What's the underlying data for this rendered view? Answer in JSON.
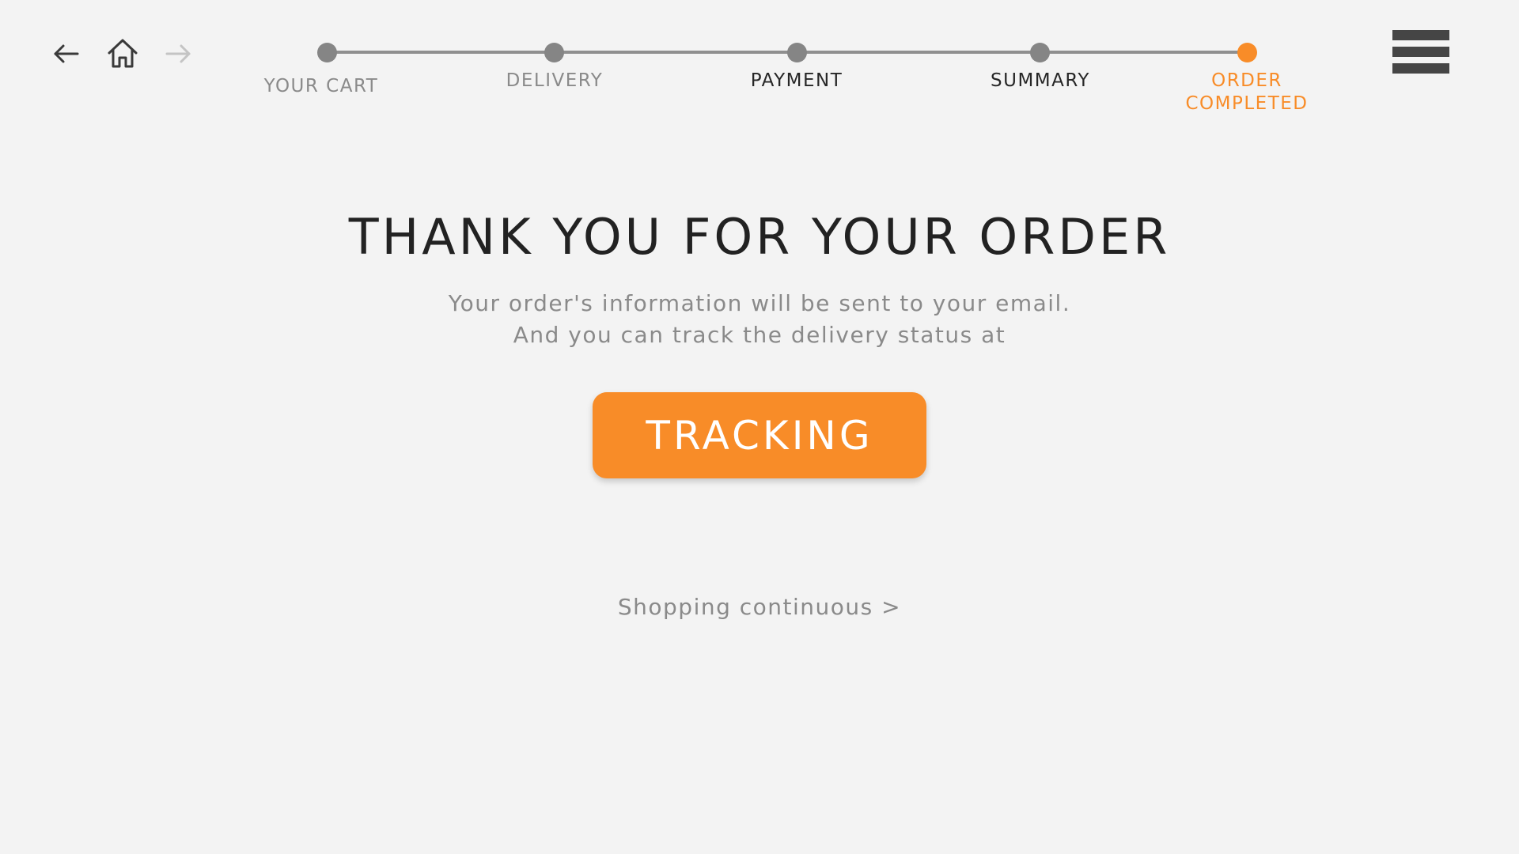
{
  "nav": {
    "back_icon": "arrow-left-icon",
    "home_icon": "home-icon",
    "forward_icon": "arrow-right-icon",
    "menu_icon": "hamburger-menu-icon"
  },
  "stepper": {
    "steps": [
      {
        "label": "YOUR CART",
        "state": "done"
      },
      {
        "label": "DELIVERY",
        "state": "done"
      },
      {
        "label": "PAYMENT",
        "state": "pending"
      },
      {
        "label": "SUMMARY",
        "state": "pending"
      },
      {
        "label_line1": "ORDER",
        "label_line2": "COMPLETED",
        "state": "active"
      }
    ]
  },
  "main": {
    "title": "THANK YOU FOR YOUR ORDER",
    "subtitle_line1": "Your order's information will be sent to your email.",
    "subtitle_line2": "And you can track the delivery status at",
    "tracking_button": "TRACKING",
    "continue_link": "Shopping continuous >"
  },
  "colors": {
    "accent": "#f88c28",
    "background": "#f3f3f3",
    "muted_text": "#8a8a8a",
    "dark_text": "#222222",
    "menu_bars": "#454545"
  }
}
